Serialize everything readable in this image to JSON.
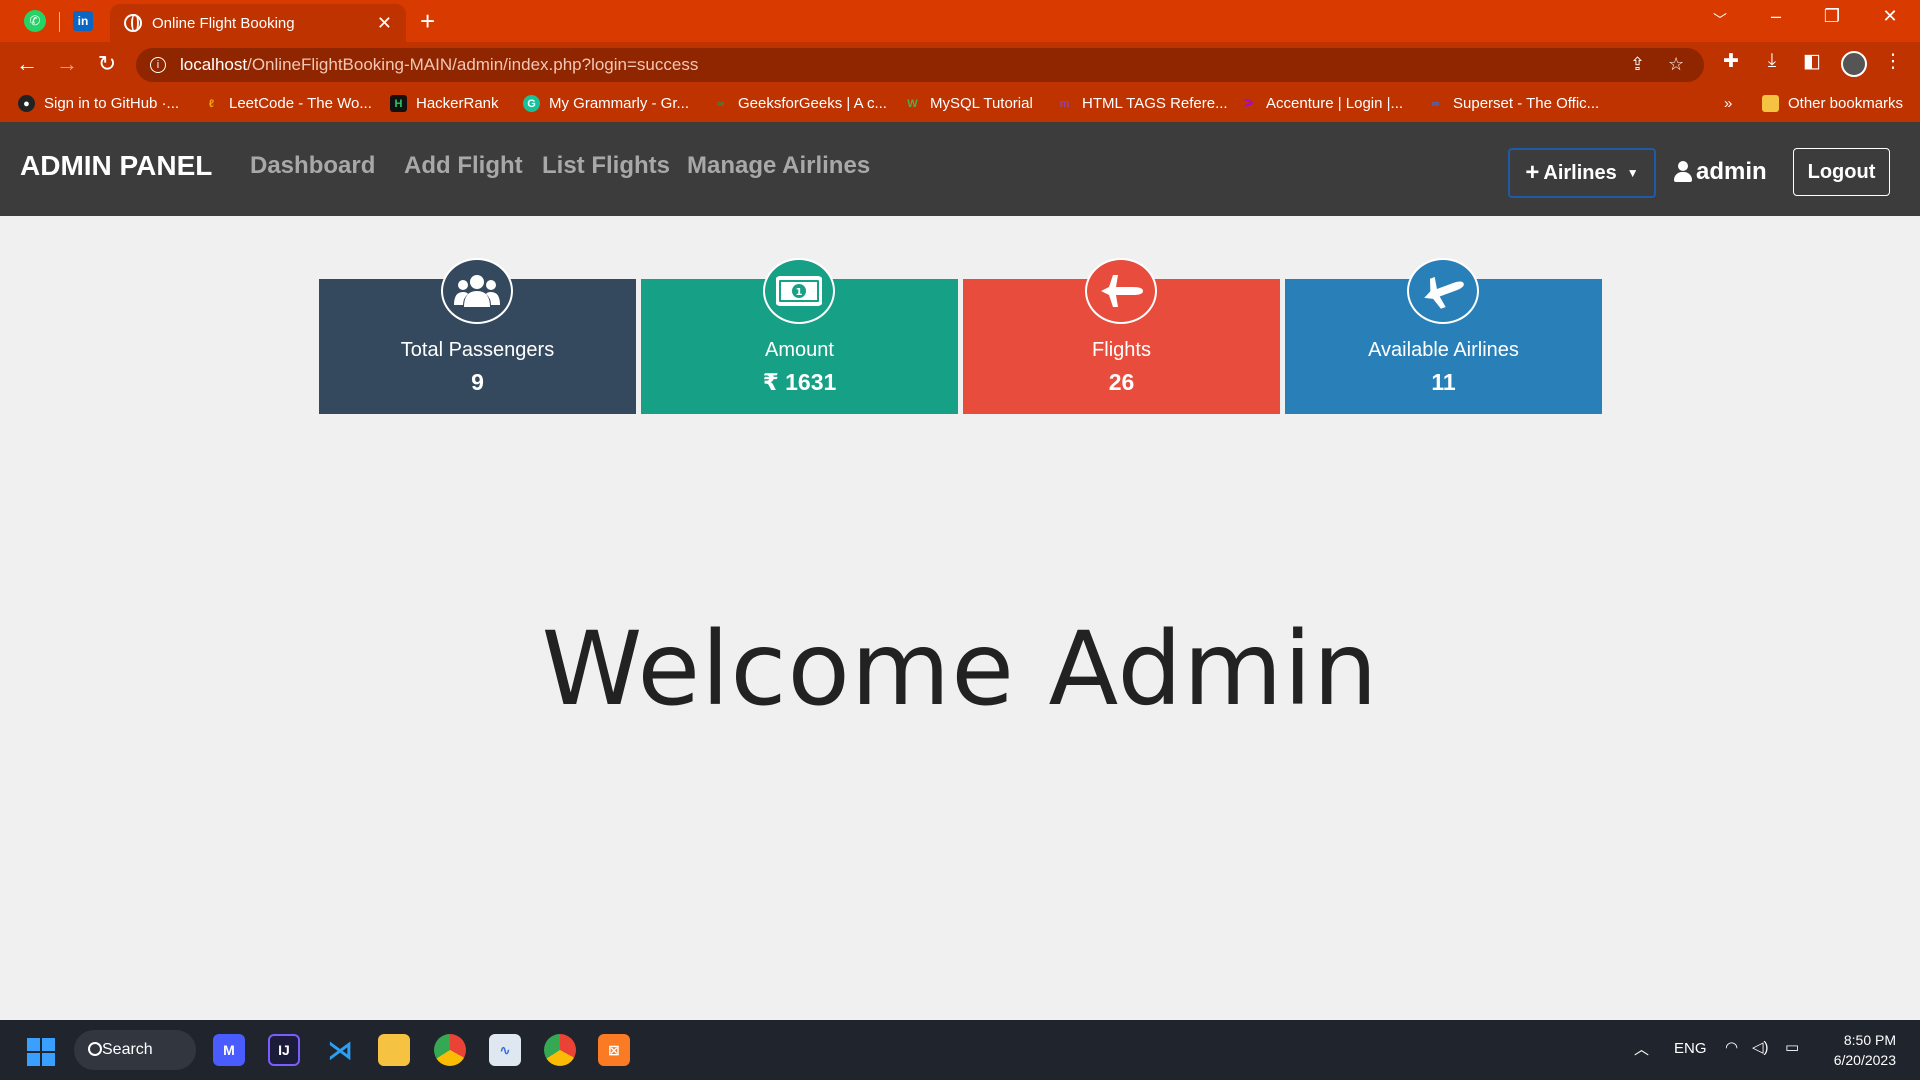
{
  "browser": {
    "pinned_tabs": [
      {
        "name": "whatsapp",
        "icon": "whatsapp-icon",
        "glyph": "✆"
      },
      {
        "name": "linkedin",
        "icon": "linkedin-icon",
        "glyph": "in"
      }
    ],
    "active_tab_title": "Online Flight Booking",
    "url_host": "localhost",
    "url_path": "/OnlineFlightBooking-MAIN/admin/index.php?login=success",
    "bookmarks": [
      "Sign in to GitHub ·...",
      "LeetCode - The Wo...",
      "HackerRank",
      "My Grammarly - Gr...",
      "GeeksforGeeks | A c...",
      "MySQL Tutorial",
      "HTML TAGS Refere...",
      "Accenture | Login |...",
      "Superset - The Offic..."
    ],
    "bookmarks_overflow": "»",
    "other_bookmarks": "Other bookmarks",
    "theme_color": "#d93a00"
  },
  "navbar": {
    "brand": "ADMIN PANEL",
    "links": [
      "Dashboard",
      "Add Flight",
      "List Flights",
      "Manage Airlines"
    ],
    "airlines_button": "Airlines",
    "user": "admin",
    "logout": "Logout"
  },
  "stats": [
    {
      "label": "Total Passengers",
      "value": "9",
      "color": "#34495e",
      "icon": "users-icon"
    },
    {
      "label": "Amount",
      "value": "₹ 1631",
      "color": "#16a085",
      "icon": "money-icon"
    },
    {
      "label": "Flights",
      "value": "26",
      "color": "#e74c3c",
      "icon": "plane-icon"
    },
    {
      "label": "Available Airlines",
      "value": "11",
      "color": "#2980b9",
      "icon": "plane-icon"
    }
  ],
  "welcome": "Welcome Admin",
  "taskbar": {
    "search": "Search",
    "language": "ENG",
    "time": "8:50 PM",
    "date": "6/20/2023"
  }
}
